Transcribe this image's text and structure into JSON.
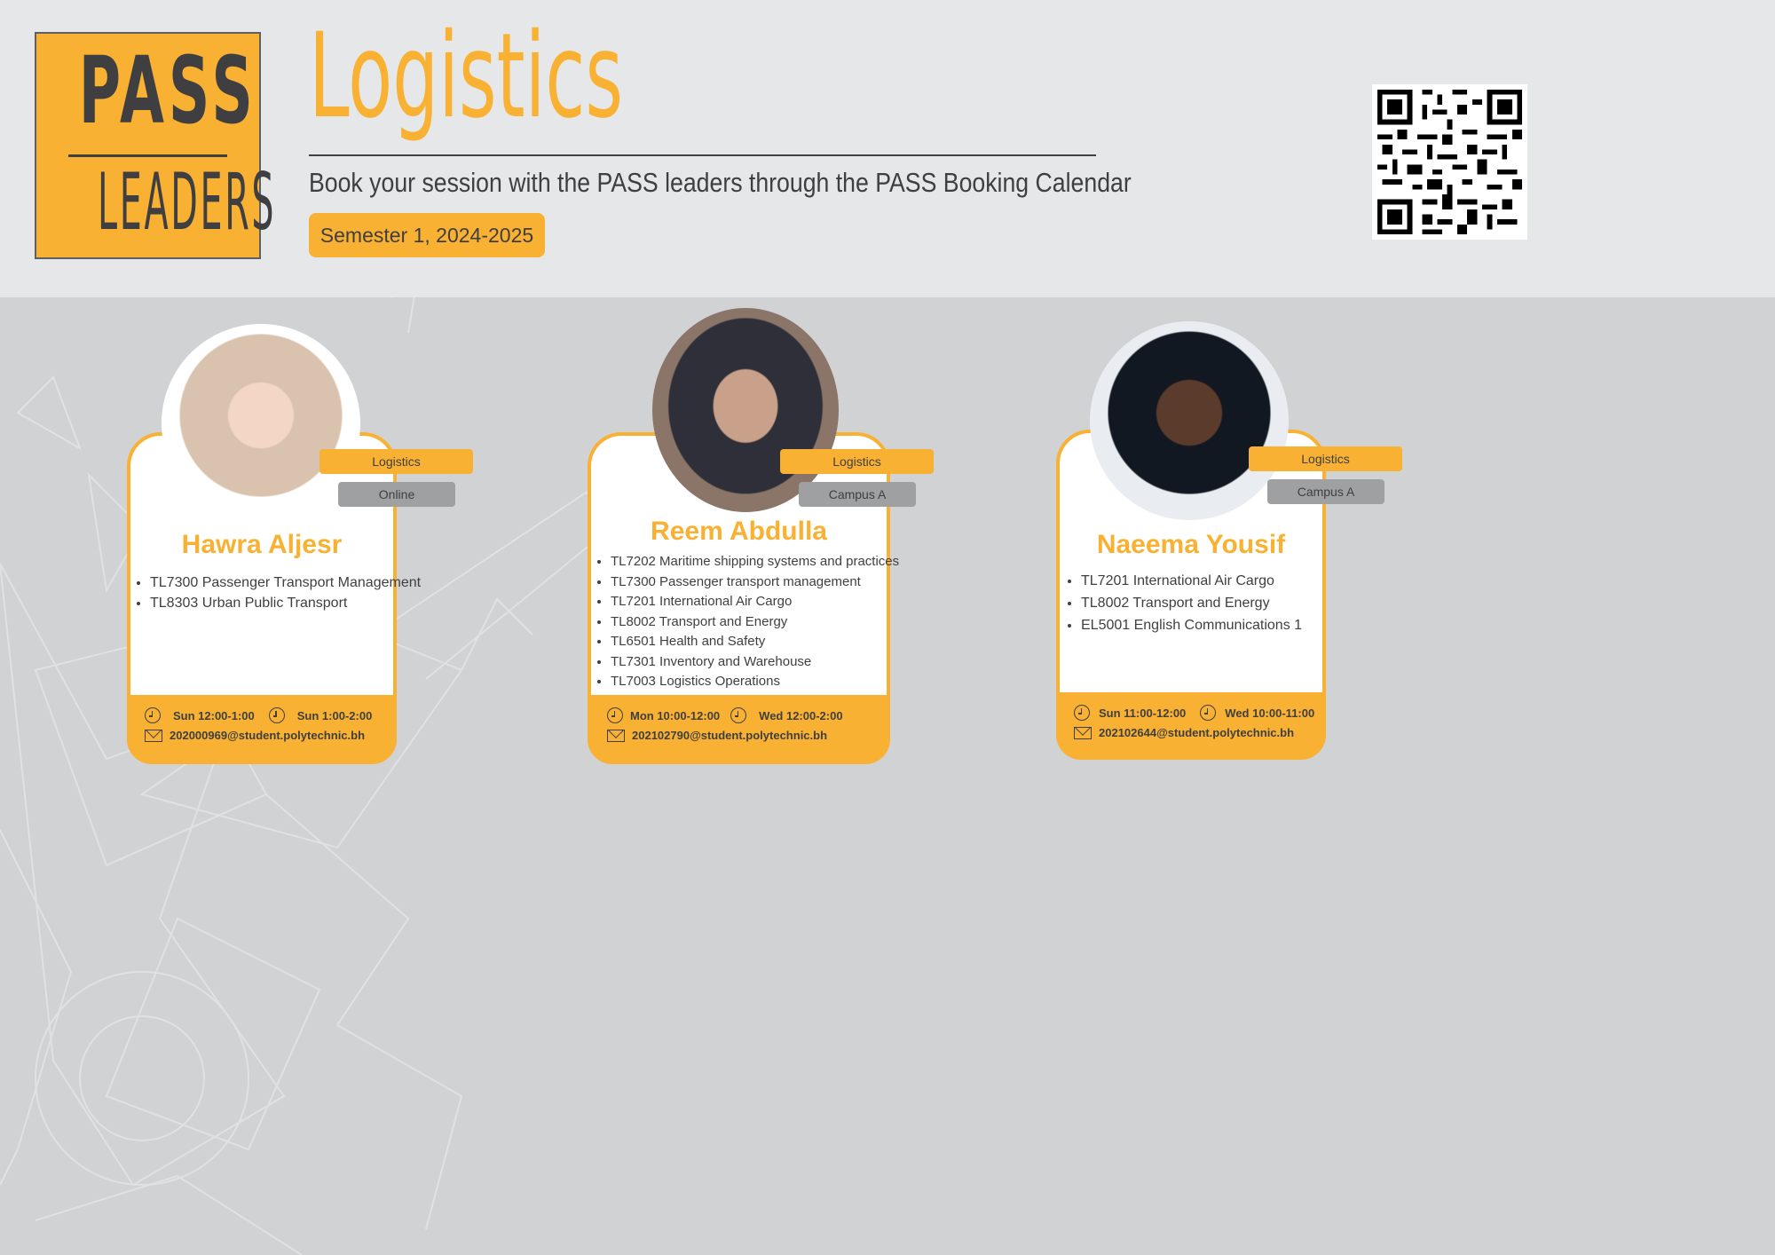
{
  "header": {
    "logo_top": "PASS",
    "logo_bottom": "LEADERS",
    "title": "Logistics",
    "subtitle": "Book your session with the PASS leaders through the PASS Booking Calendar",
    "semester": "Semester 1, 2024-2025"
  },
  "colors": {
    "accent": "#f8b133",
    "text": "#3f3f41",
    "header_bg": "#e6e7e8",
    "page_bg": "#d1d2d4",
    "tag_grey": "#9fa0a2"
  },
  "leaders": [
    {
      "name": "Hawra Aljesr",
      "subject": "Logistics",
      "location": "Online",
      "courses": [
        "TL7300 Passenger Transport Management",
        "TL8303 Urban Public Transport"
      ],
      "slot1": "Sun 12:00-1:00",
      "slot2": "Sun 1:00-2:00",
      "email": "202000969@student.polytechnic.bh"
    },
    {
      "name": "Reem Abdulla",
      "subject": "Logistics",
      "location": "Campus A",
      "courses": [
        "TL7202 Maritime shipping systems and practices",
        "TL7300 Passenger transport management",
        "TL7201 International Air Cargo",
        "TL8002 Transport and Energy",
        "TL6501 Health and Safety",
        "TL7301 Inventory and Warehouse",
        "TL7003 Logistics Operations"
      ],
      "slot1": "Mon 10:00-12:00",
      "slot2": "Wed 12:00-2:00",
      "email": "202102790@student.polytechnic.bh"
    },
    {
      "name": "Naeema Yousif",
      "subject": "Logistics",
      "location": "Campus A",
      "courses": [
        "TL7201 International Air Cargo",
        "TL8002 Transport and Energy",
        "EL5001 English Communications 1"
      ],
      "slot1": "Sun 11:00-12:00",
      "slot2": "Wed 10:00-11:00",
      "email": "202102644@student.polytechnic.bh"
    }
  ]
}
